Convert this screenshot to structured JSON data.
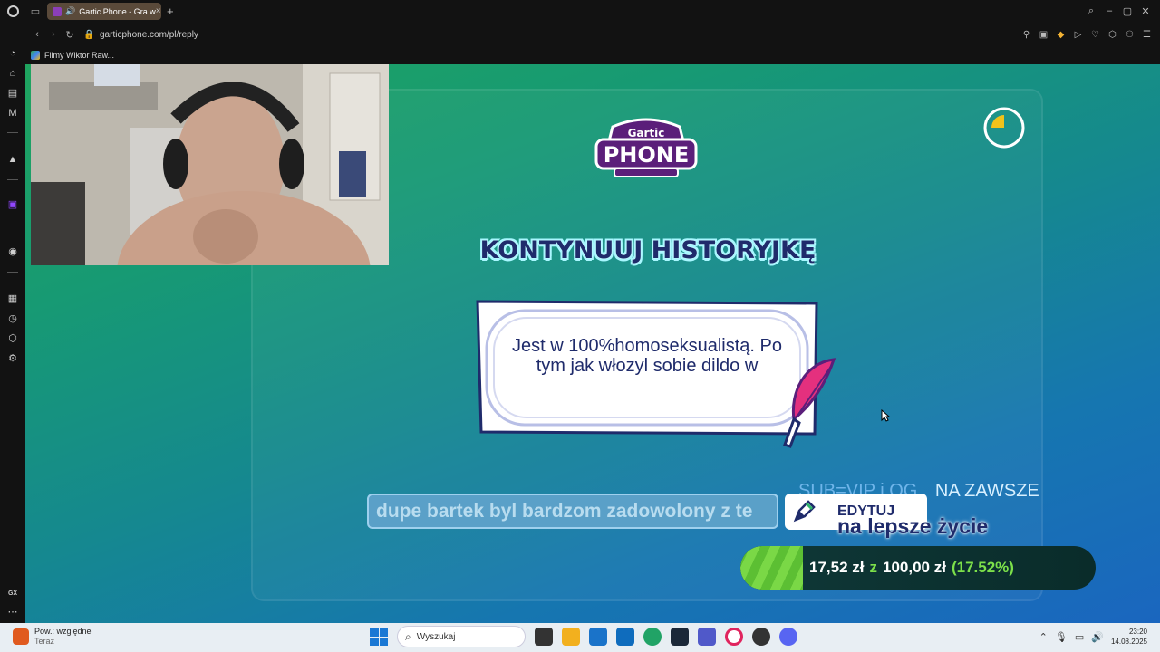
{
  "browser": {
    "tab_title": "Gartic Phone - Gra w",
    "url": "garticphone.com/pl/reply",
    "bookmark": "Filmy Wiktor Raw..."
  },
  "game": {
    "logo_top": "Gartic",
    "logo_bottom": "PHONE",
    "heading": "KONTYNUUJ HISTORYJKĘ",
    "prompt_text": "Jest w 100%homoseksualistą. Po tym jak włozyl sobie dildo w",
    "answer_value": "dupe bartek byl bardzom zadowolony z te",
    "edit_button": "EDYTUJ",
    "timer_fraction_elapsed": 0.25
  },
  "stream_overlay": {
    "sub_text_1": "SUB=VIP i OG",
    "sub_text_2": "NA ZAWSZE",
    "sub_line_2": "na lepsze życie",
    "goal_current": "17,52 zł",
    "goal_separator": "z",
    "goal_target": "100,00 zł",
    "goal_percent": "(17.52%)",
    "goal_fraction": 0.1752
  },
  "taskbar": {
    "weather_title": "Pow.: względne",
    "weather_sub": "Teraz",
    "search_placeholder": "Wyszukaj",
    "time": "23:20",
    "date": "14.08.2025"
  },
  "colors": {
    "heading": "#1f2b6b",
    "goal_green": "#7ce04a",
    "brand_purple": "#5b1f7a"
  }
}
